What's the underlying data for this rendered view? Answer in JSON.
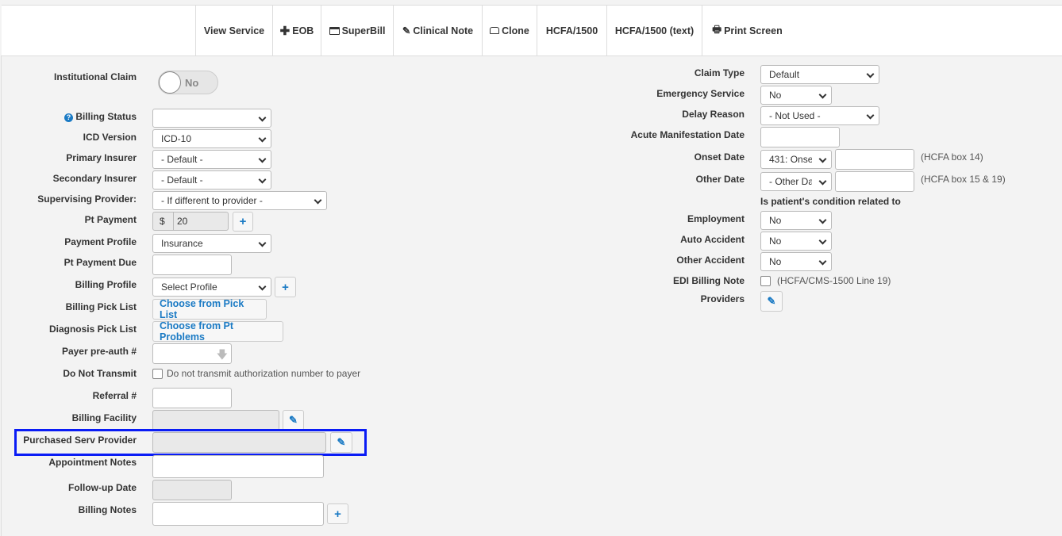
{
  "toolbar": {
    "buttons": [
      {
        "label": "View Service",
        "icon": ""
      },
      {
        "label": "EOB",
        "icon": "plus-icon"
      },
      {
        "label": "SuperBill",
        "icon": "credit-card-icon"
      },
      {
        "label": "Clinical Note",
        "icon": "pencil-icon"
      },
      {
        "label": "Clone",
        "icon": "inbox-icon"
      },
      {
        "label": "HCFA/1500",
        "icon": ""
      },
      {
        "label": "HCFA/1500 (text)",
        "icon": ""
      },
      {
        "label": "Print Screen",
        "icon": "print-icon"
      }
    ]
  },
  "left": {
    "institutional_claim": {
      "label": "Institutional Claim",
      "value": "No"
    },
    "billing_status": {
      "label": "Billing Status",
      "value": ""
    },
    "icd_version": {
      "label": "ICD Version",
      "value": "ICD-10"
    },
    "primary_insurer": {
      "label": "Primary Insurer",
      "value": "- Default -"
    },
    "secondary_insurer": {
      "label": "Secondary Insurer",
      "value": "- Default -"
    },
    "supervising_provider": {
      "label": "Supervising Provider:",
      "value": "- If different to provider -"
    },
    "pt_payment": {
      "label": "Pt Payment",
      "currency": "$",
      "value": "20"
    },
    "payment_profile": {
      "label": "Payment Profile",
      "value": "Insurance"
    },
    "pt_payment_due": {
      "label": "Pt Payment Due",
      "value": ""
    },
    "billing_profile": {
      "label": "Billing Profile",
      "value": "Select Profile"
    },
    "billing_pick_list": {
      "label": "Billing Pick List",
      "button": "Choose from Pick List"
    },
    "diagnosis_pick_list": {
      "label": "Diagnosis Pick List",
      "button": "Choose from Pt Problems"
    },
    "payer_preauth": {
      "label": "Payer pre-auth #",
      "value": ""
    },
    "do_not_transmit": {
      "label": "Do Not Transmit",
      "checkbox_text": "Do not transmit authorization number to payer",
      "checked": false
    },
    "referral": {
      "label": "Referral #",
      "value": ""
    },
    "billing_facility": {
      "label": "Billing Facility",
      "value": ""
    },
    "purchased_serv_provider": {
      "label": "Purchased Serv Provider",
      "value": ""
    },
    "appointment_notes": {
      "label": "Appointment Notes",
      "value": ""
    },
    "followup_date": {
      "label": "Follow-up Date",
      "value": ""
    },
    "billing_notes": {
      "label": "Billing Notes",
      "value": ""
    }
  },
  "right": {
    "claim_type": {
      "label": "Claim Type",
      "value": "Default"
    },
    "emergency_service": {
      "label": "Emergency Service",
      "value": "No"
    },
    "delay_reason": {
      "label": "Delay Reason",
      "value": "- Not Used -"
    },
    "acute_manifestation_date": {
      "label": "Acute Manifestation Date",
      "value": ""
    },
    "onset_date": {
      "label": "Onset Date",
      "value": "431: Onset",
      "date": "",
      "note": "(HCFA box 14)"
    },
    "other_date": {
      "label": "Other Date",
      "value": "- Other Da",
      "date": "",
      "note": "(HCFA box 15 & 19)"
    },
    "condition_heading": "Is patient's condition related to",
    "employment": {
      "label": "Employment",
      "value": "No"
    },
    "auto_accident": {
      "label": "Auto Accident",
      "value": "No"
    },
    "other_accident": {
      "label": "Other Accident",
      "value": "No"
    },
    "edi_billing_note": {
      "label": "EDI Billing Note",
      "checkbox_text": "(HCFA/CMS-1500 Line 19)",
      "checked": false
    },
    "providers": {
      "label": "Providers"
    }
  },
  "colors": {
    "accent": "#1a7ac4",
    "highlight": "#0a1cf5",
    "background": "#f3f3f3"
  }
}
